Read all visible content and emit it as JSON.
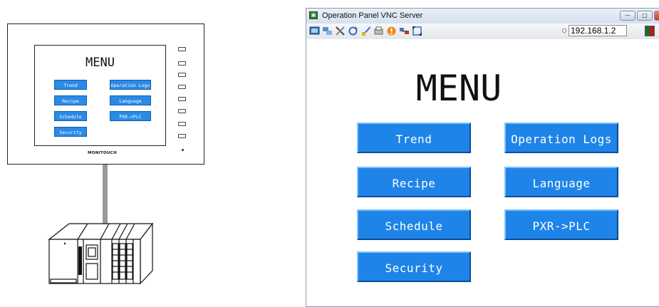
{
  "hmi_device": {
    "menu_title": "MENU",
    "buttons": [
      "Trend",
      "Operation Logs",
      "Recipe",
      "Language",
      "Schedule",
      "PXR->PLC",
      "Security"
    ],
    "brand": "MONITOUCH"
  },
  "window": {
    "title": "Operation Panel VNC Server",
    "minimize_icon": "minimize-icon",
    "maximize_icon": "maximize-icon",
    "close_icon": "close-icon"
  },
  "toolbar": {
    "icons": [
      "screen-icon",
      "transfer-icon",
      "tools-icon",
      "refresh-icon",
      "paint-icon",
      "print-icon",
      "alert-icon",
      "network-icon",
      "fullscreen-icon"
    ],
    "ip_address": "192.168.1.2"
  },
  "screen": {
    "menu_title": "MENU",
    "buttons": {
      "trend": "Trend",
      "operation_logs": "Operation Logs",
      "recipe": "Recipe",
      "language": "Language",
      "schedule": "Schedule",
      "pxr_plc": "PXR->PLC",
      "security": "Security"
    }
  },
  "colors": {
    "button_blue": "#1e84e8",
    "title_bar": "#d6e1ef",
    "status_green": "#1f6b2a",
    "status_red": "#b21c1c"
  }
}
